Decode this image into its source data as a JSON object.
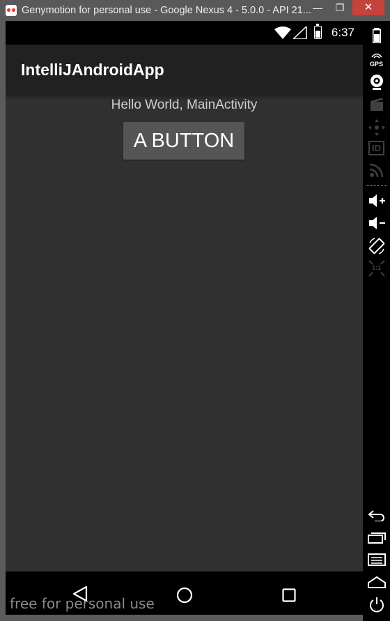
{
  "window": {
    "title": "Genymotion for personal use - Google Nexus 4 - 5.0.0 - API 21...",
    "minimize_glyph": "—",
    "maximize_glyph": "❐",
    "close_glyph": "✕"
  },
  "status_bar": {
    "time": "6:37"
  },
  "app": {
    "title": "IntelliJAndroidApp",
    "hello_text": "Hello World, MainActivity",
    "button_label": "A BUTTON"
  },
  "watermark": "free for personal use",
  "toolbar": {
    "gps_label": "GPS",
    "id_label": "ID",
    "pixel_perfect_label": "1:1"
  },
  "colors": {
    "close_button": "#c7423a",
    "screen_background": "#303030",
    "action_bar": "#212121",
    "button": "#555555"
  }
}
